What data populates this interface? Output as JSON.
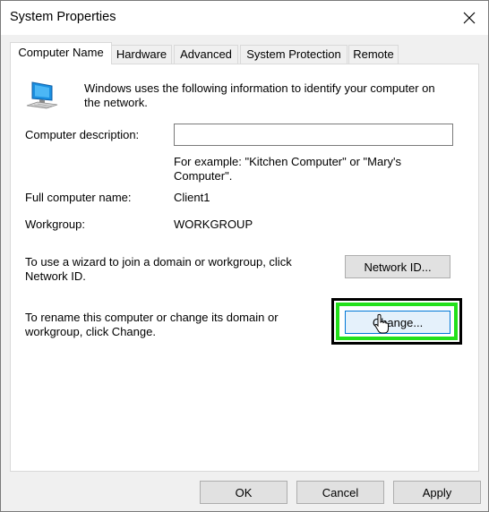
{
  "window": {
    "title": "System Properties"
  },
  "tabs": [
    {
      "label": "Computer Name",
      "active": true
    },
    {
      "label": "Hardware",
      "active": false
    },
    {
      "label": "Advanced",
      "active": false
    },
    {
      "label": "System Protection",
      "active": false
    },
    {
      "label": "Remote",
      "active": false
    }
  ],
  "panel": {
    "intro_line1": "Windows uses the following information to identify your computer on",
    "intro_line2": "the network.",
    "description_label": "Computer description:",
    "description_value": "",
    "example_line1": "For example: \"Kitchen Computer\" or \"Mary's",
    "example_line2": "Computer\".",
    "full_name_label": "Full computer name:",
    "full_name_value": "Client1",
    "workgroup_label": "Workgroup:",
    "workgroup_value": "WORKGROUP",
    "network_text_line1": "To use a wizard to join a domain or workgroup, click",
    "network_text_line2": "Network ID.",
    "network_id_button": "Network ID...",
    "rename_text_line1": "To rename this computer or change its domain or",
    "rename_text_line2": "workgroup, click Change.",
    "change_button": "Change..."
  },
  "footer": {
    "ok": "OK",
    "cancel": "Cancel",
    "apply": "Apply"
  },
  "icons": {
    "computer": "computer-monitor-icon",
    "close": "close-icon",
    "cursor": "mouse-cursor-icon"
  },
  "colors": {
    "highlight": "#22e01a",
    "accent": "#0078d7"
  }
}
